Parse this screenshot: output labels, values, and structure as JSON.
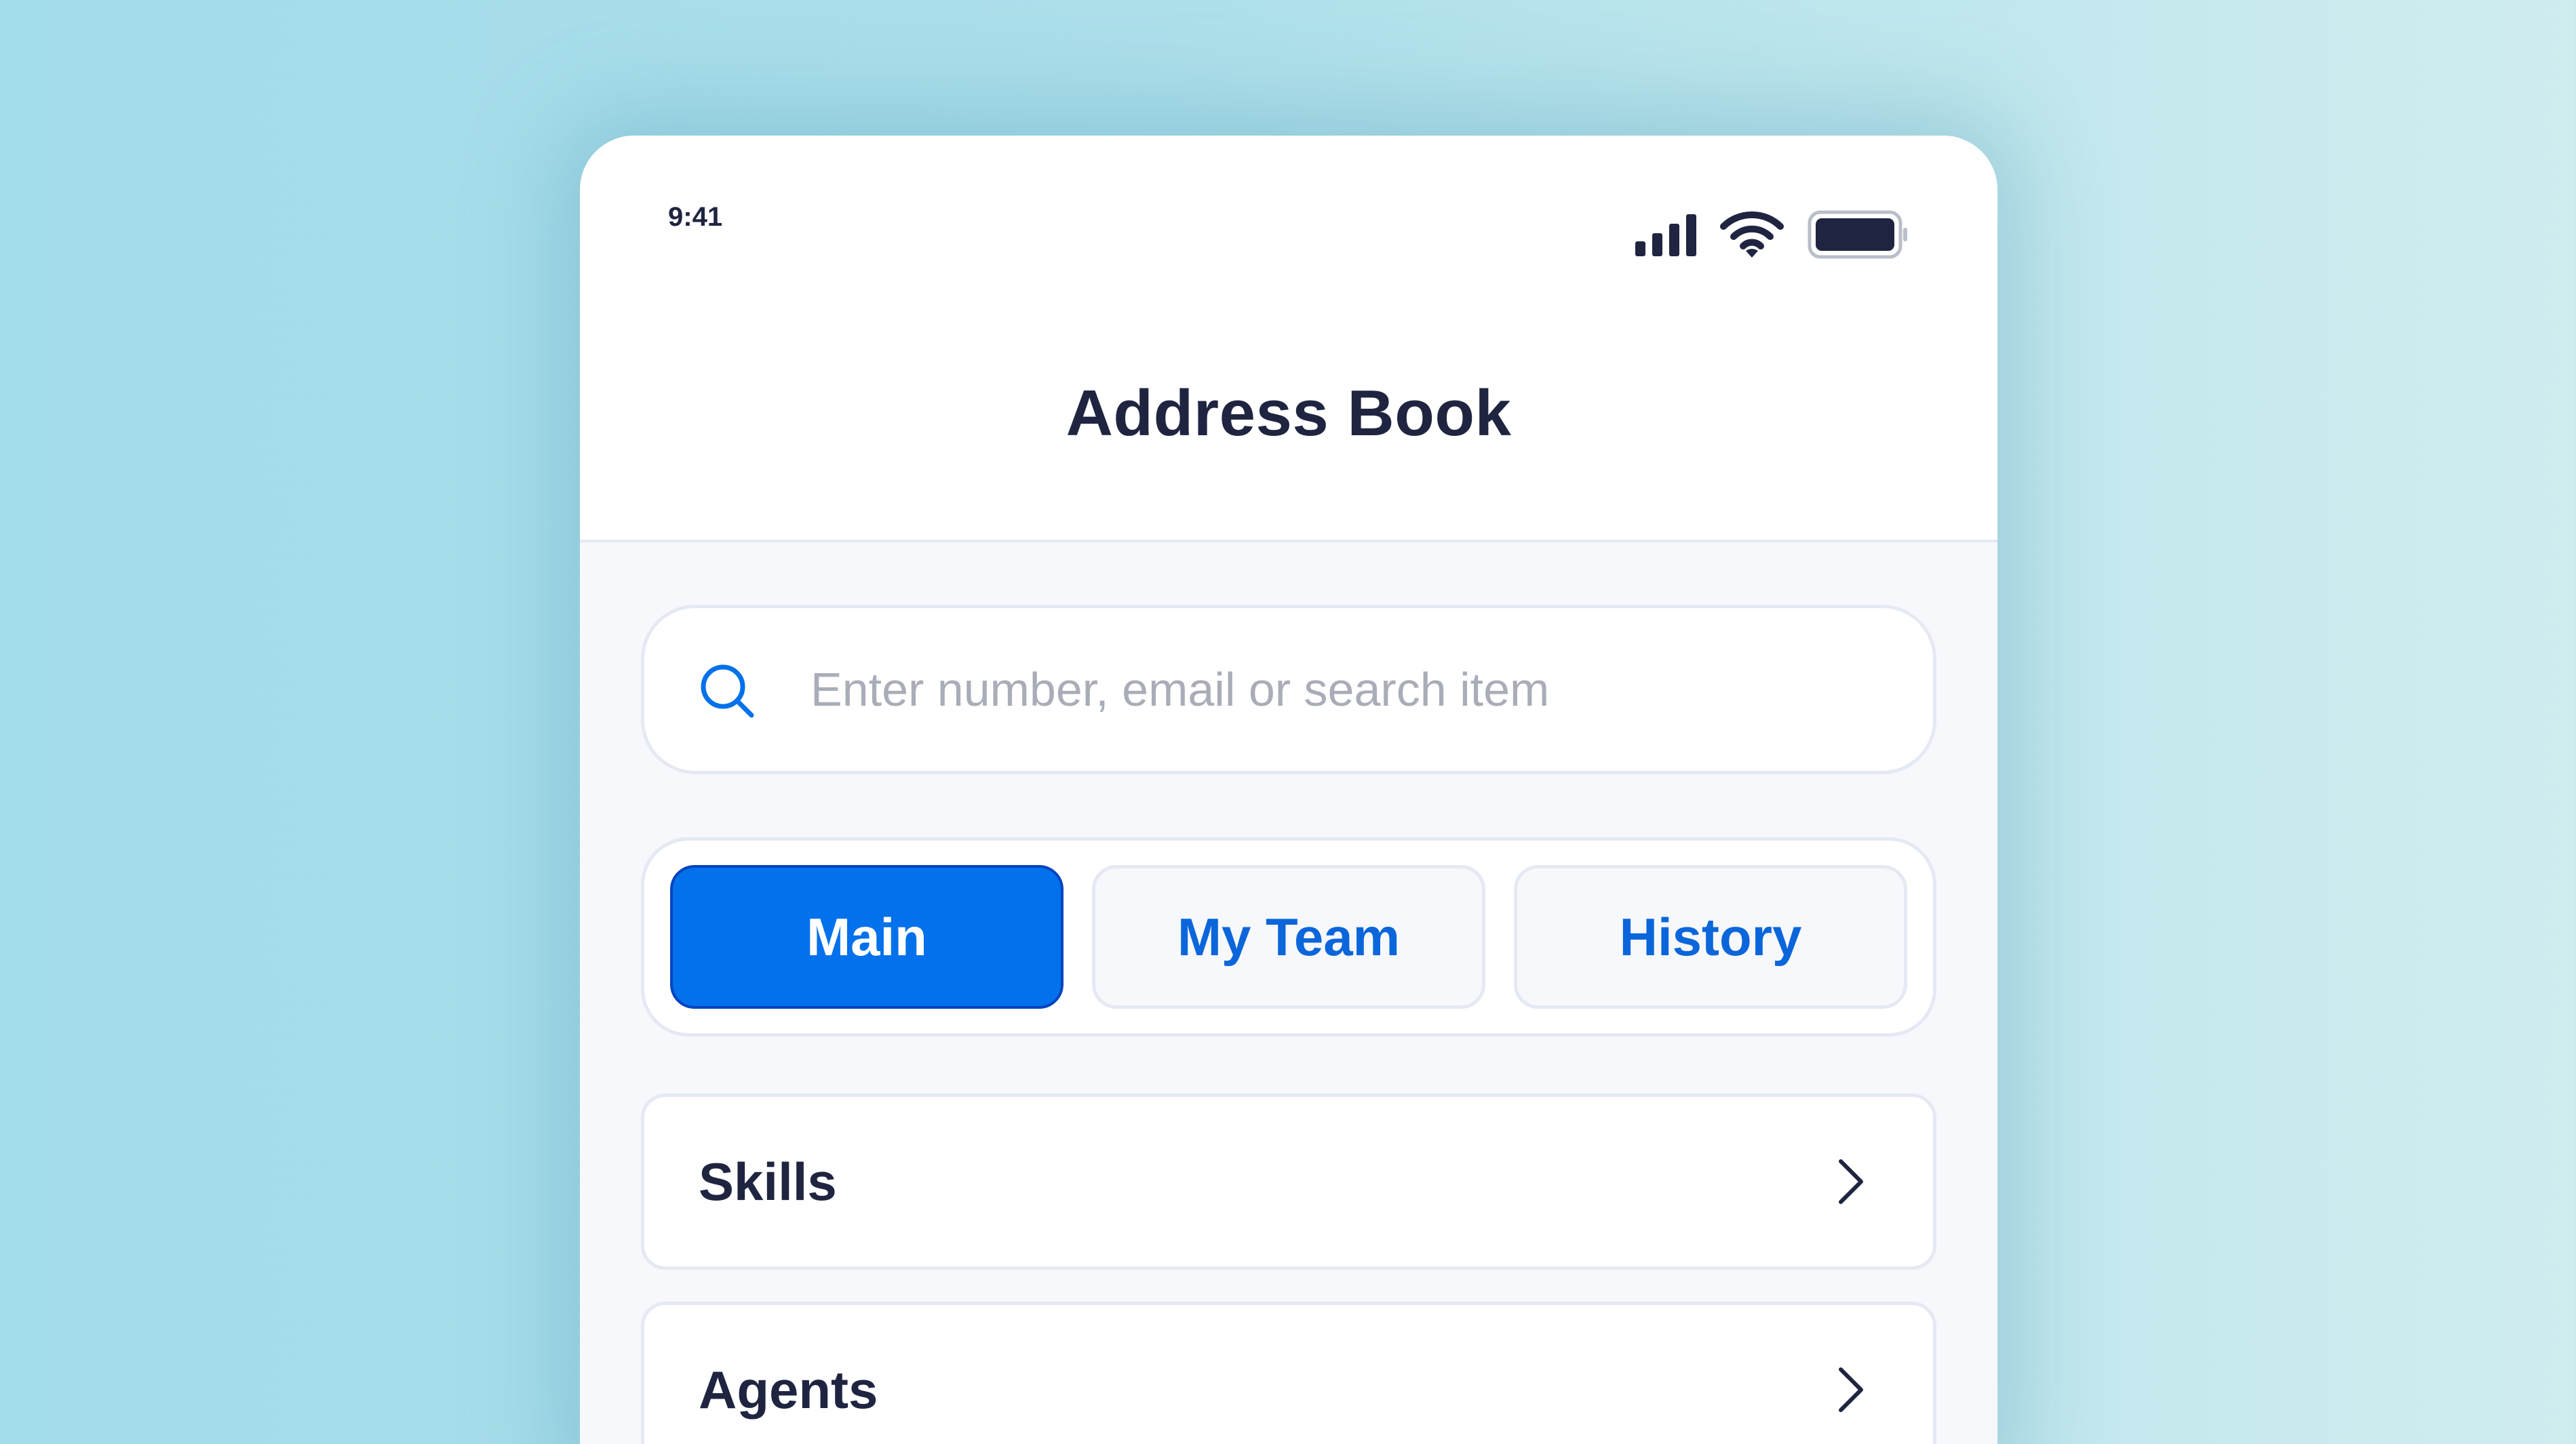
{
  "status_bar": {
    "time": "9:41",
    "icons": [
      "cellular-signal-icon",
      "wifi-icon",
      "battery-icon"
    ]
  },
  "header": {
    "title": "Address Book"
  },
  "search": {
    "icon": "search-icon",
    "placeholder": "Enter number, email or search item",
    "value": ""
  },
  "tabs": [
    {
      "label": "Main",
      "active": true
    },
    {
      "label": "My Team",
      "active": false
    },
    {
      "label": "History",
      "active": false
    }
  ],
  "list": [
    {
      "label": "Skills",
      "icon": "chevron-right-icon"
    },
    {
      "label": "Agents",
      "icon": "chevron-right-icon"
    }
  ],
  "colors": {
    "accent": "#0271eb",
    "accent_text": "#0a66da",
    "text_dark": "#1f2540",
    "surface": "#f6f8fc",
    "border": "#e4e9f3"
  }
}
